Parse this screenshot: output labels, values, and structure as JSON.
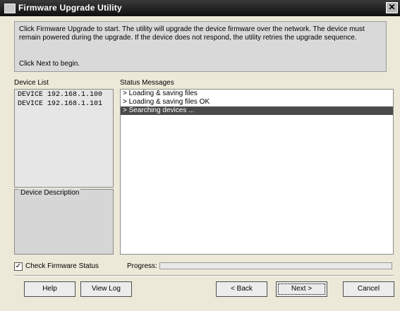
{
  "window": {
    "title": "Firmware Upgrade Utility",
    "close_glyph": "✕"
  },
  "info": {
    "text": "Click Firmware Upgrade to start. The utility will upgrade the device firmware over the network. The device must remain powered during the upgrade. If the device does not respond, the utility retries the upgrade sequence.",
    "next_hint": "Click Next to begin."
  },
  "device_list": {
    "label": "Device List",
    "items": [
      "DEVICE  192.168.1.100",
      "DEVICE  192.168.1.101"
    ]
  },
  "device_description": {
    "label": "Device Description"
  },
  "status": {
    "label": "Status Messages",
    "messages": [
      "> Loading & saving files",
      "> Loading & saving files OK",
      "> Searching devices ..."
    ]
  },
  "options": {
    "check_label": "Check Firmware Status",
    "progress_label": "Progress:",
    "progress_fraction": 0
  },
  "buttons": {
    "help": "Help",
    "view_log": "View Log",
    "back": "< Back",
    "next": "Next >",
    "cancel": "Cancel"
  }
}
